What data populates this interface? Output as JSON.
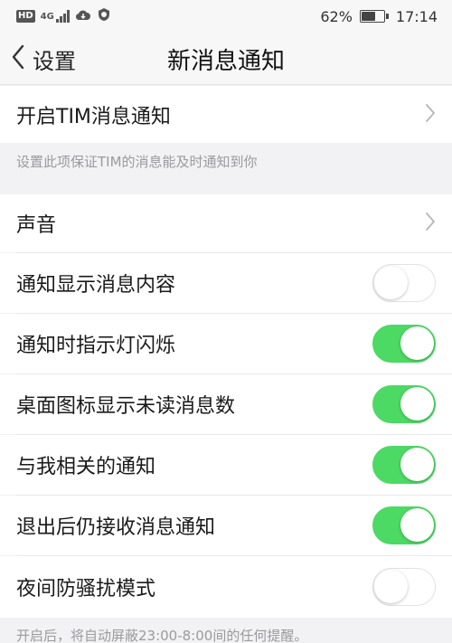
{
  "status_bar": {
    "network": "4G",
    "battery": "62%",
    "battery_level": 0.62,
    "time": "17:14",
    "icons": [
      "hd-icon",
      "signal-icon",
      "cloud-download-icon",
      "shield-icon",
      "battery-icon"
    ]
  },
  "nav": {
    "back_label": "设置",
    "title": "新消息通知"
  },
  "section1": {
    "enable_label": "开启TIM消息通知",
    "note": "设置此项保证TIM的消息能及时通知到你"
  },
  "section2": {
    "sound_label": "声音",
    "toggles": [
      {
        "label": "通知显示消息内容",
        "on": false
      },
      {
        "label": "通知时指示灯闪烁",
        "on": true
      },
      {
        "label": "桌面图标显示未读消息数",
        "on": true
      },
      {
        "label": "与我相关的通知",
        "on": true
      },
      {
        "label": "退出后仍接收消息通知",
        "on": true
      },
      {
        "label": "夜间防骚扰模式",
        "on": false
      }
    ],
    "footer_note": "开启后，将自动屏蔽23:00-8:00间的任何提醒。"
  },
  "colors": {
    "toggle_on": "#4cd964",
    "background": "#f2f2f4"
  }
}
